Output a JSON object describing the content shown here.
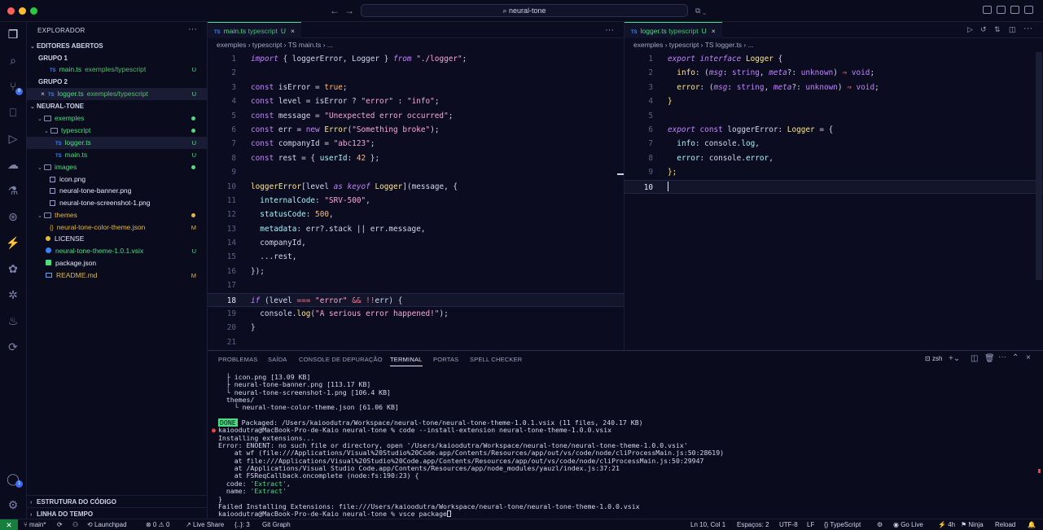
{
  "window": {
    "search": "neural-tone",
    "nav_back": "←",
    "nav_forward": "→",
    "copilot_glyph": "⧉ ⌄"
  },
  "sidebar": {
    "title": "EXPLORADOR",
    "more": "···",
    "open_editors": "EDITORES ABERTOS",
    "group1": "GRUPO 1",
    "group2": "GRUPO 2",
    "open_files": [
      {
        "name": "main.ts",
        "path": "exemples/typescript",
        "status": "U"
      },
      {
        "name": "logger.ts",
        "path": "exemples/typescript",
        "status": "U"
      }
    ],
    "project": "NEURAL-TONE",
    "tree": {
      "exemples": "exemples",
      "typescript": "typescript",
      "logger": "logger.ts",
      "main": "main.ts",
      "images": "images",
      "icon": "icon.png",
      "banner": "neural-tone-banner.png",
      "screenshot": "neural-tone-screenshot-1.png",
      "themes": "themes",
      "color_theme": "neural-tone-color-theme.json",
      "license": "LICENSE",
      "vsix": "neural-tone-theme-1.0.1.vsix",
      "package": "package.json",
      "readme": "README.md",
      "status_u": "U",
      "status_m": "M"
    },
    "outline": "ESTRUTURA DO CÓDIGO",
    "timeline": "LINHA DO TEMPO"
  },
  "editor_left": {
    "tab_label": "main.ts",
    "tab_sub": "typescript",
    "tab_status": "U",
    "tab_close": "×",
    "breadcrumb": "exemples › typescript › TS main.ts › ...",
    "more": "···",
    "lines": [
      "1",
      "2",
      "3",
      "4",
      "5",
      "6",
      "7",
      "8",
      "9",
      "10",
      "11",
      "12",
      "13",
      "14",
      "15",
      "16",
      "17",
      "18",
      "19",
      "20",
      "21"
    ]
  },
  "editor_right": {
    "tab_label": "logger.ts",
    "tab_sub": "typescript",
    "tab_status": "U",
    "tab_close": "×",
    "breadcrumb": "exemples › typescript › TS logger.ts › ...",
    "lines": [
      "1",
      "2",
      "3",
      "4",
      "5",
      "6",
      "7",
      "8",
      "9",
      "10"
    ]
  },
  "panel": {
    "tabs": [
      "PROBLEMAS",
      "SAÍDA",
      "CONSOLE DE DEPURAÇÃO",
      "TERMINAL",
      "PORTAS",
      "SPELL CHECKER"
    ],
    "shell": "zsh",
    "terminal": {
      "l1": "  ├ icon.png [13.09 KB]",
      "l2": "  ├ neural-tone-banner.png [113.17 KB]",
      "l3": "  └ neural-tone-screenshot-1.png [106.4 KB]",
      "l4": "  themes/",
      "l5": "    └ neural-tone-color-theme.json [61.06 KB]",
      "done": "DONE",
      "l6": " Packaged: /Users/kaioodutra/Workspace/neural-tone/neural-tone-theme-1.0.1.vsix (11 files, 240.17 KB)",
      "l7": "kaioodutra@MacBook-Pro-de-Kaio neural-tone % code --install-extension neural-tone-theme-1.0.0.vsix",
      "l8": "Installing extensions...",
      "l9": "Error: ENOENT: no such file or directory, open '/Users/kaioodutra/Workspace/neural-tone/neural-tone-theme-1.0.0.vsix'",
      "l10": "    at wf (file:///Applications/Visual%20Studio%20Code.app/Contents/Resources/app/out/vs/code/node/cliProcessMain.js:50:28619)",
      "l11": "    at file:///Applications/Visual%20Studio%20Code.app/Contents/Resources/app/out/vs/code/node/cliProcessMain.js:50:29947",
      "l12": "    at /Applications/Visual Studio Code.app/Contents/Resources/app/node_modules/yauzl/index.js:37:21",
      "l13": "    at FSReqCallback.oncomplete (node:fs:190:23) {",
      "l14a": "  code: ",
      "l14b": "'Extract'",
      "l14c": ",",
      "l15a": "  name: ",
      "l15b": "'Extract'",
      "l16": "}",
      "l17": "Failed Installing Extensions: file:///Users/kaioodutra/Workspace/neural-tone/neural-tone-theme-1.0.0.vsix",
      "l18": "kaioodutra@MacBook-Pro-de-Kaio neural-tone % vsce package"
    }
  },
  "statusbar": {
    "branch": "main*",
    "problems": "⊗ 0 ⚠ 0",
    "launchpad": "Launchpad",
    "liveshare": "Live Share",
    "braces": "{..}: 3",
    "gitgraph": "Git Graph",
    "position": "Ln 10, Col 1",
    "spaces": "Espaços: 2",
    "encoding": "UTF-8",
    "eol": "LF",
    "language": "TypeScript",
    "golive": "Go Live",
    "time": "4h",
    "ninja": "Ninja",
    "reload": "Reload"
  },
  "colors": {
    "background": "#0a0b1d",
    "accent_green": "#4ade80",
    "accent_yellow": "#e5b93c",
    "keyword": "#c084fc"
  }
}
